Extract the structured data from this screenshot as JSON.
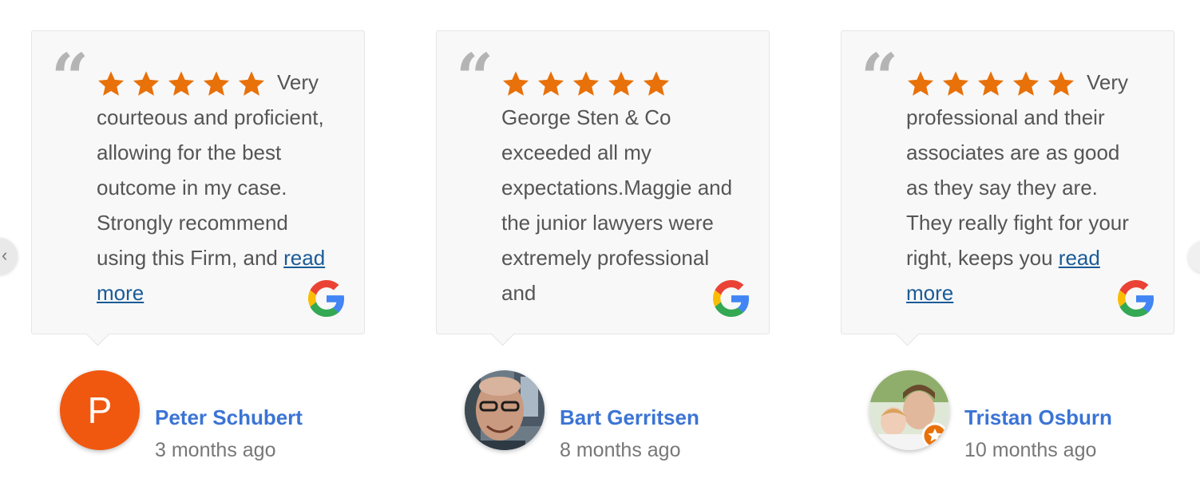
{
  "colors": {
    "accent_star": "#e8710a",
    "name_link": "#3b74d4",
    "read_more": "#1a5b97",
    "avatar_letter_bg": "#f05810"
  },
  "carousel": {
    "prev_icon": "chevron-left-icon",
    "next_icon": "chevron-right-icon",
    "prev_glyph": "‹"
  },
  "reviews": [
    {
      "rating": 5,
      "text": "Very courteous and proficient, allowing for the best outcome in my case. Strongly recommend using this Firm, and",
      "read_more": "read more",
      "author": "Peter Schubert",
      "time_ago": "3 months ago",
      "avatar_letter": "P",
      "source_icon": "google-icon"
    },
    {
      "rating": 5,
      "text": "George Sten & Co exceeded all my expectations.Maggie and the junior lawyers were extremely professional and",
      "read_more": "",
      "author": "Bart Gerritsen",
      "time_ago": "8 months ago",
      "avatar_letter": "",
      "source_icon": "google-icon"
    },
    {
      "rating": 5,
      "text": "Very professional and their associates are as good as they say they are. They really fight for your right, keeps you",
      "read_more": "read more",
      "author": "Tristan Osburn",
      "time_ago": "10 months ago",
      "avatar_letter": "",
      "source_icon": "google-icon"
    }
  ]
}
